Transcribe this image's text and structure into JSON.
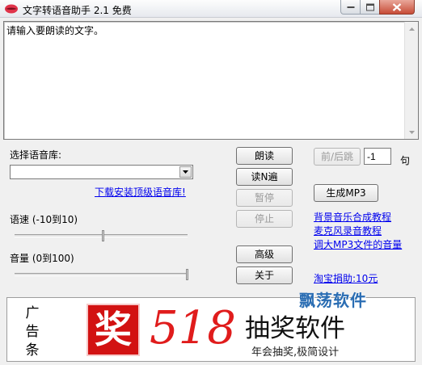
{
  "window": {
    "title": "文字转语音助手 2.1 免费"
  },
  "text_area": {
    "value": "请输入要朗读的文字。"
  },
  "voice_lib": {
    "label": "选择语音库:",
    "selected": "",
    "download_link": "下载安装顶级语音库!"
  },
  "speed": {
    "label": "语速 (-10到10)",
    "value": 0,
    "min": -10,
    "max": 10
  },
  "volume": {
    "label": "音量 (0到100)",
    "value": 100,
    "min": 0,
    "max": 100
  },
  "buttons": {
    "read": "朗读",
    "read_n": "读N遍",
    "pause": "暂停",
    "stop": "停止",
    "advanced": "高级",
    "about": "关于",
    "prev_next": "前/后跳",
    "generate_mp3": "生成MP3"
  },
  "sentence_jump": {
    "value": "-1",
    "unit": "句"
  },
  "links": {
    "bg_music": "背景音乐合成教程",
    "mic_record": "麦克风录音教程",
    "mp3_volume": "调大MP3文件的音量",
    "donate": "淘宝捐助:10元"
  },
  "ad": {
    "side_text": [
      "广",
      "告",
      "条"
    ],
    "logo_char": "奖",
    "number": "518",
    "title": "抽奖软件",
    "subtitle": "年会抽奖,极简设计"
  },
  "watermark": "飘荡软件",
  "colors": {
    "link": "#0000ee",
    "ad_red": "#d21212",
    "close_button": "#c74c37",
    "watermark": "#2a6db3"
  }
}
